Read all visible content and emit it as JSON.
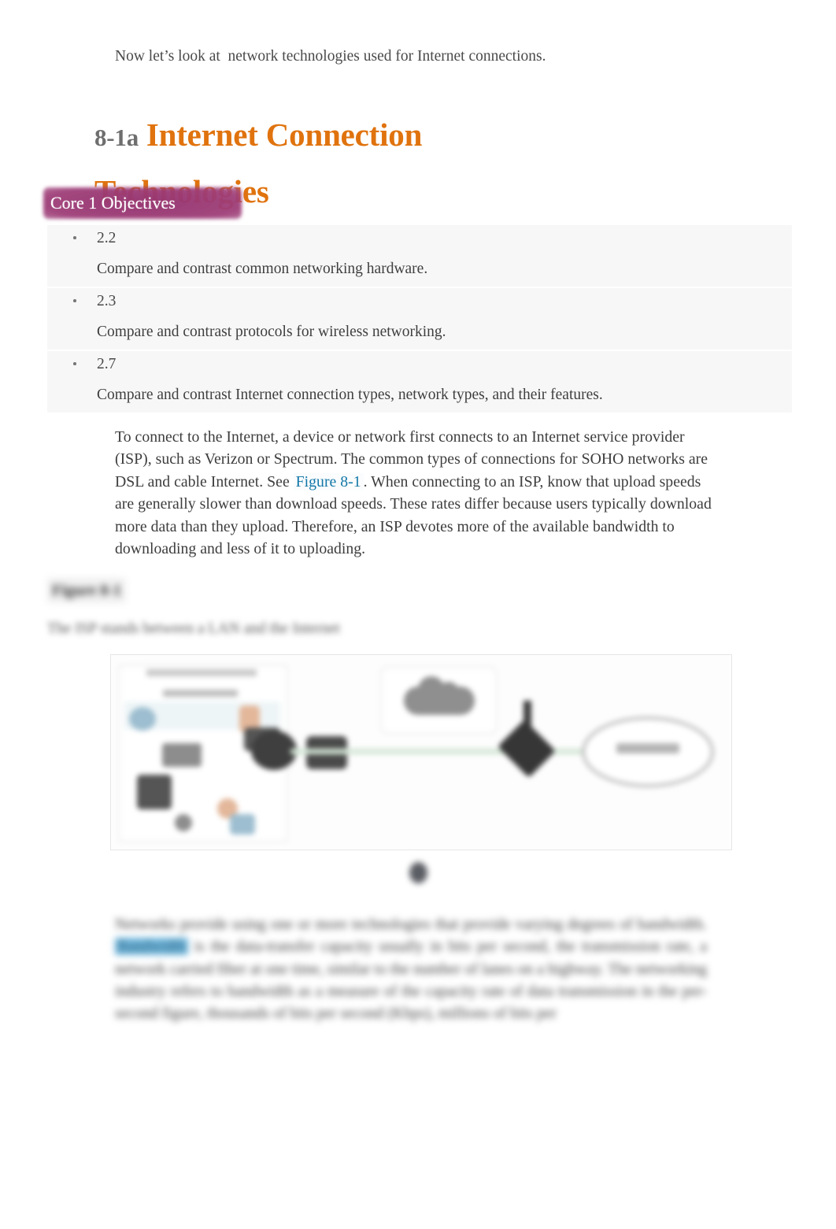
{
  "intro": {
    "text": "Now let’s look at  network technologies used for Internet connections."
  },
  "heading": {
    "number": "8-1a",
    "title": "Internet Connection Technologies",
    "number_color": "#6e6e6e",
    "title_color": "#e0730e"
  },
  "objectives": {
    "badge_label": "Core 1 Objectives",
    "badge_color": "#963470",
    "items": [
      {
        "code": "2.2",
        "description": "Compare and contrast common networking hardware."
      },
      {
        "code": "2.3",
        "description": "Compare and contrast protocols for wireless networking."
      },
      {
        "code": "2.7",
        "description": "Compare and contrast Internet connection types, network types, and their features."
      }
    ]
  },
  "body": {
    "part1": "To connect to the Internet, a device or network first connects to an Internet service provider (ISP), such as Verizon or Spectrum. The common types of connections for SOHO networks are DSL and cable Internet. See",
    "link_label": "Figure 8-1",
    "part2": ". When connecting to an ISP, know that upload speeds are generally slower than download speeds. These rates differ because users typically download more data than they upload. Therefore, an ISP devotes more of the available bandwidth to downloading and less of it to uploading.",
    "link_color": "#1277a8"
  },
  "figure": {
    "caption_number": "Figure 8-1",
    "caption_text": "The ISP stands between a LAN and the Internet",
    "blurred": true
  },
  "bottom_paragraph": {
    "part1": "Networks provide using one or more technologies that provide varying degrees of bandwidth.",
    "term": "Bandwidth",
    "part2": "is the data-transfer capacity usually in bits per second, the transmission rate, a network carried fiber at one time, similar to the number of lanes on a highway. The networking industry refers to bandwidth as a measure of the capacity rate of data transmission in the per-second figure, thousands of bits per second (Kbps), millions of bits per",
    "highlight_color": "#6fb6dc",
    "blurred": true
  }
}
